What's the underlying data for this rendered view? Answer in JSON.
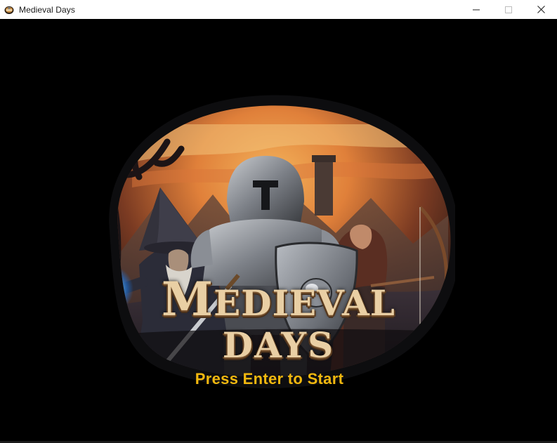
{
  "window": {
    "title": "Medieval Days",
    "icon": "game-app-icon",
    "controls": {
      "minimize_icon": "minimize-icon",
      "maximize_icon": "maximize-icon",
      "close_icon": "close-icon"
    }
  },
  "title_screen": {
    "logo_line1_first": "M",
    "logo_line1_rest": "EDIEVAL",
    "logo_line2": "DAYS",
    "start_prompt": "Press Enter to Start",
    "colors": {
      "background": "#000000",
      "prompt": "#f2b80f",
      "logo_text": "#e9cfa4",
      "sky_glow": "#e8843a",
      "magic_orb": "#4fb8ff"
    },
    "characters": [
      "wizard",
      "knight",
      "archer"
    ]
  }
}
